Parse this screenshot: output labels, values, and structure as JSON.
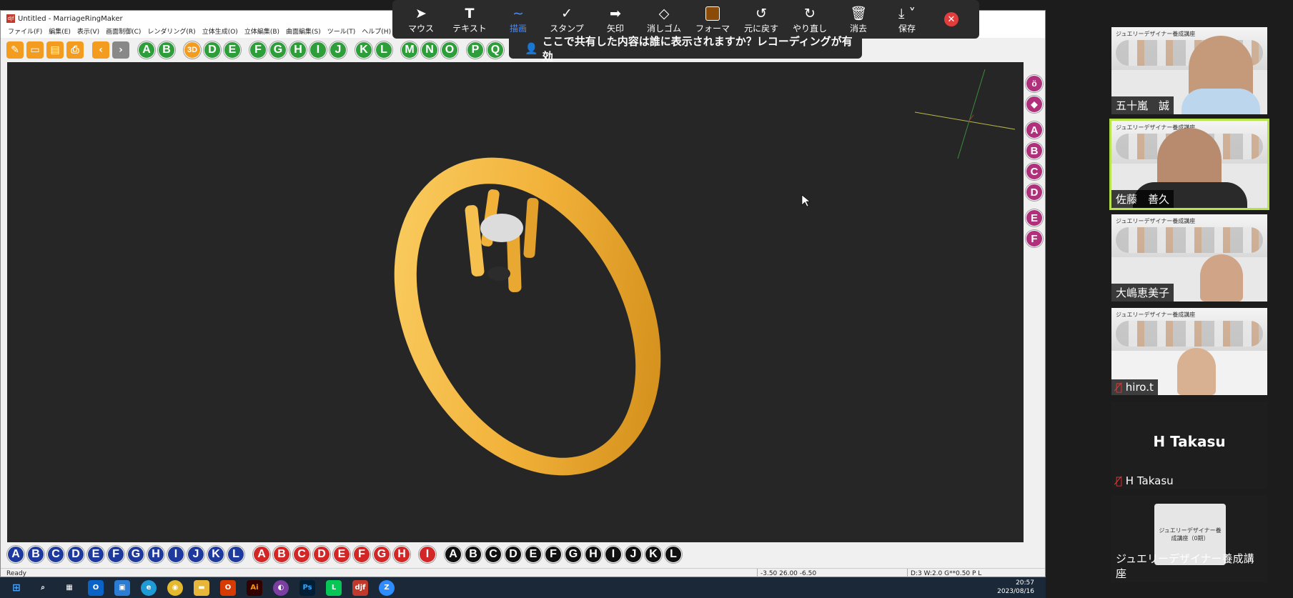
{
  "window": {
    "title": "Untitled - MarriageRingMaker",
    "app_icon": "djf",
    "controls": [
      "minimize",
      "restore",
      "close"
    ]
  },
  "menu": [
    "ファイル(F)",
    "編集(E)",
    "表示(V)",
    "画面制御(C)",
    "レンダリング(R)",
    "立体生成(O)",
    "立体編集(B)",
    "曲面編集(S)",
    "ツール(T)",
    "ヘルプ(H)"
  ],
  "top_toolbar": {
    "file_buttons": [
      "new-icon",
      "open-icon",
      "save-icon",
      "print-icon"
    ],
    "nav_buttons": [
      "back-icon",
      "forward-icon"
    ],
    "letters_1": [
      "A",
      "B"
    ],
    "letters_2": [
      "3D",
      "D",
      "E"
    ],
    "letters_3": [
      "F",
      "G",
      "H",
      "I",
      "J"
    ],
    "letters_4": [
      "K",
      "L"
    ],
    "letters_5": [
      "M",
      "N",
      "O"
    ],
    "letters_6": [
      "P",
      "Q"
    ]
  },
  "zoom_toolbar": {
    "items": [
      {
        "label": "マウス",
        "icon": "cursor-icon"
      },
      {
        "label": "テキスト",
        "icon": "text-icon"
      },
      {
        "label": "描画",
        "icon": "draw-icon",
        "active": true
      },
      {
        "label": "スタンプ",
        "icon": "stamp-icon"
      },
      {
        "label": "矢印",
        "icon": "arrow-icon"
      },
      {
        "label": "消しゴム",
        "icon": "eraser-icon"
      },
      {
        "label": "フォーマ",
        "icon": "format-icon"
      },
      {
        "label": "元に戻す",
        "icon": "undo-icon"
      },
      {
        "label": "やり直し",
        "icon": "redo-icon"
      },
      {
        "label": "消去",
        "icon": "trash-icon"
      },
      {
        "label": "保存",
        "icon": "save-download-icon"
      }
    ],
    "notice": "ここで共有した内容は誰に表示されますか？レコーディングが有効"
  },
  "right_toolbar": [
    "ring-icon",
    "gem-icon",
    "A",
    "B",
    "C",
    "D",
    "E",
    "F"
  ],
  "bottom_toolbar": {
    "blue": [
      "A",
      "B",
      "C",
      "D",
      "E",
      "F",
      "G",
      "H",
      "I",
      "J",
      "K",
      "L"
    ],
    "red": [
      "A",
      "B",
      "C",
      "D",
      "E",
      "F",
      "G",
      "H"
    ],
    "red_single": [
      "I"
    ],
    "black": [
      "A",
      "B",
      "C",
      "D",
      "E",
      "F",
      "G",
      "H",
      "I",
      "J",
      "K",
      "L"
    ]
  },
  "status": {
    "left": "Ready",
    "coords": "-3.50 26.00 -6.50",
    "info": "D:3 W:2.0 G**0.50 P  L"
  },
  "participants": [
    {
      "name": "五十嵐　誠",
      "banner": "ジュエリーデザイナー養成講座",
      "speaking": false
    },
    {
      "name": "佐藤　善久",
      "banner": "ジュエリーデザイナー養成講座",
      "speaking": true
    },
    {
      "name": "大嶋恵美子",
      "banner": "ジュエリーデザイナー養成講座",
      "speaking": false
    },
    {
      "name": "hiro.t",
      "banner": "ジュエリーデザイナー養成講座",
      "speaking": false,
      "muted": true
    },
    {
      "name": "H Takasu",
      "display": "H Takasu",
      "muted": true
    },
    {
      "name": "ジュエリーデザイナー養成講座",
      "logo_text": "ジュエリーデザイナー養成講座（0期）"
    }
  ],
  "taskbar": {
    "apps": [
      "windows-icon",
      "search-icon",
      "taskview-icon",
      "outlook-icon",
      "store-icon",
      "edge-icon",
      "chrome-icon",
      "explorer-icon",
      "office-icon",
      "illustrator-icon",
      "app-icon",
      "photoshop-icon",
      "line-icon",
      "djf-icon",
      "zoom-icon"
    ],
    "time": "20:57",
    "date": "2023/08/16"
  },
  "colors": {
    "ring_gold": "#f2b23a",
    "viewport_bg": "#262626",
    "speaking_outline": "#b7e34a"
  }
}
